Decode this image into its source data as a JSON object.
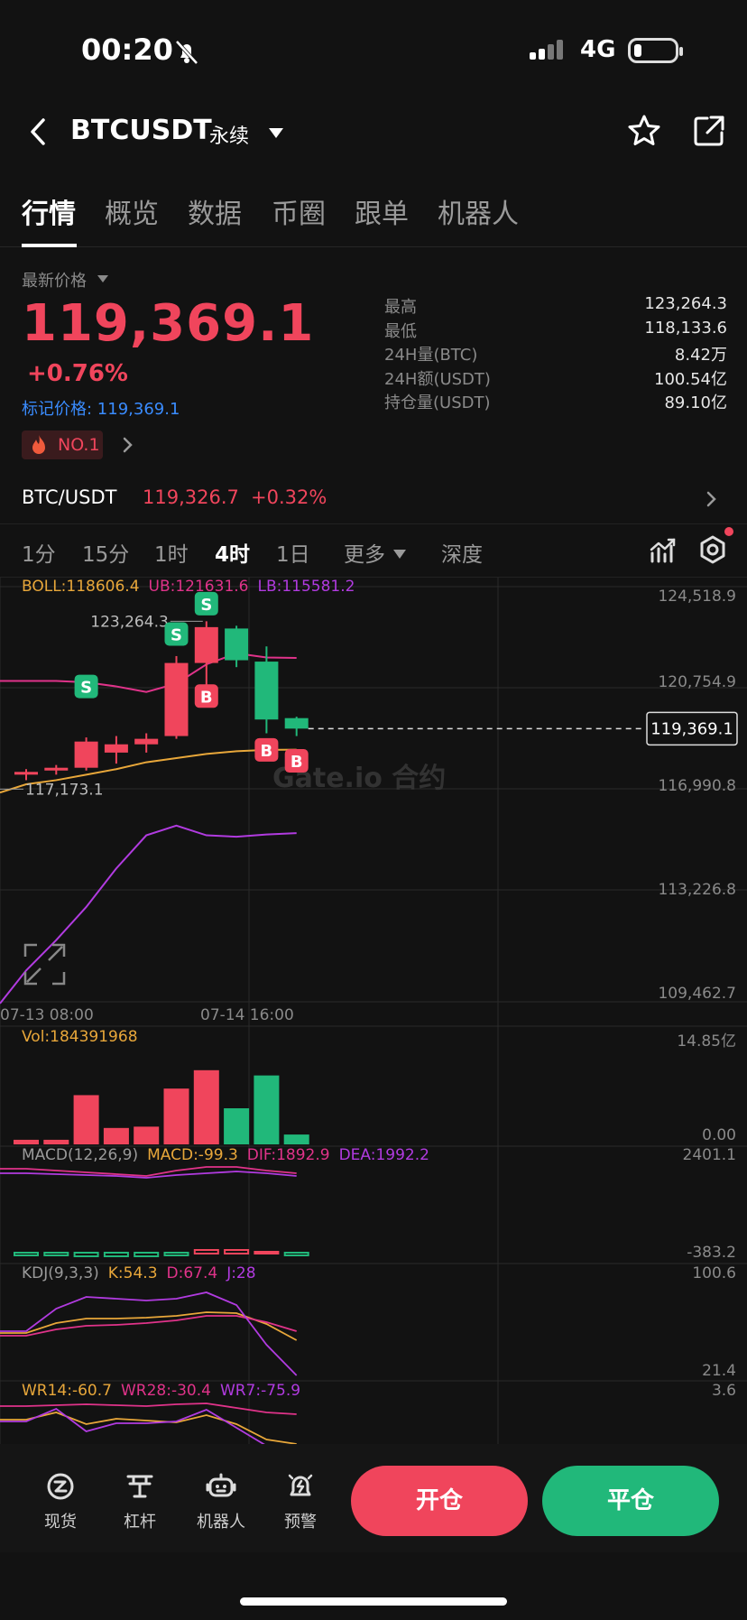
{
  "status": {
    "time": "00:20",
    "network": "4G"
  },
  "nav": {
    "symbol": "BTCUSDT",
    "contract": "永续"
  },
  "tabs": [
    "行情",
    "概览",
    "数据",
    "币圈",
    "跟单",
    "机器人"
  ],
  "price": {
    "label": "最新价格",
    "last": "119,369.1",
    "change": "+0.76%",
    "mark": "标记价格: 119,369.1",
    "rank": "NO.1"
  },
  "stats": [
    {
      "k": "最高",
      "v": "123,264.3"
    },
    {
      "k": "最低",
      "v": "118,133.6"
    },
    {
      "k": "24H量(BTC)",
      "v": "8.42万"
    },
    {
      "k": "24H额(USDT)",
      "v": "100.54亿"
    },
    {
      "k": "持仓量(USDT)",
      "v": "89.10亿"
    }
  ],
  "spot": {
    "pair": "BTC/USDT",
    "price": "119,326.7",
    "change": "+0.32%"
  },
  "intervals": {
    "items": [
      "1分",
      "15分",
      "1时",
      "4时",
      "1日"
    ],
    "more": "更多",
    "depth": "深度"
  },
  "colors": {
    "up": "#f0455c",
    "down": "#21b87a",
    "mark": "#3a8cff",
    "boll_mid": "#e8a73a",
    "boll_up": "#e0338a",
    "boll_lo": "#b13be0"
  },
  "chart_data": {
    "type": "candlestick",
    "boll": {
      "label": "BOLL:118606.4",
      "ub": "UB:121631.6",
      "lb": "LB:115581.2"
    },
    "y_ticks": [
      "124,518.9",
      "120,754.9",
      "116,990.8",
      "113,226.8",
      "109,462.7"
    ],
    "ylim": [
      109462.7,
      124518.9
    ],
    "x_ticks": [
      "07-13 08:00",
      "07-14 16:00"
    ],
    "current_price": "119,369.1",
    "current_value": 119369.1,
    "high_label": "123,264.3",
    "low_label": "117,173.1",
    "candles": [
      {
        "o": 117700,
        "h": 117900,
        "l": 117500,
        "c": 117800
      },
      {
        "o": 117850,
        "h": 118050,
        "l": 117700,
        "c": 117950
      },
      {
        "o": 117950,
        "h": 119050,
        "l": 117850,
        "c": 118900
      },
      {
        "o": 118500,
        "h": 119100,
        "l": 118100,
        "c": 118800
      },
      {
        "o": 118800,
        "h": 119200,
        "l": 118500,
        "c": 119000
      },
      {
        "o": 119100,
        "h": 122000,
        "l": 119000,
        "c": 121750
      },
      {
        "o": 121750,
        "h": 123264.3,
        "l": 120900,
        "c": 123050
      },
      {
        "o": 123000,
        "h": 123100,
        "l": 121600,
        "c": 121850
      },
      {
        "o": 121800,
        "h": 122350,
        "l": 119200,
        "c": 119700
      },
      {
        "o": 119750,
        "h": 119800,
        "l": 119100,
        "c": 119369.1
      }
    ],
    "trade_marks": [
      {
        "i": 2,
        "type": "S",
        "price": 120900
      },
      {
        "i": 5,
        "type": "S",
        "price": 122800
      },
      {
        "i": 6,
        "type": "S",
        "price": 123900
      },
      {
        "i": 6,
        "type": "B",
        "price": 120550
      },
      {
        "i": 8,
        "type": "B",
        "price": 118600
      },
      {
        "i": 9,
        "type": "B",
        "price": 118200
      }
    ],
    "boll_upper": [
      121100,
      121100,
      121050,
      120900,
      120700,
      121000,
      121700,
      122100,
      121950,
      121931.6
    ],
    "boll_middle": [
      117350,
      117500,
      117700,
      117900,
      118150,
      118300,
      118450,
      118550,
      118600,
      118606.4
    ],
    "boll_lower": [
      110600,
      111700,
      112900,
      114300,
      115500,
      115850,
      115500,
      115450,
      115530,
      115581.2
    ],
    "volume": {
      "label": "Vol:184391968",
      "max_label": "14.85亿",
      "min_label": "0.00",
      "max": 14.85,
      "values": [
        0.7,
        0.7,
        7.5,
        2.5,
        2.7,
        8.5,
        11.3,
        5.5,
        10.5,
        1.5
      ]
    },
    "macd": {
      "label": "MACD(12,26,9)",
      "macd": "MACD:-99.3",
      "dif": "DIF:1892.9",
      "dea": "DEA:1992.2",
      "max_label": "2401.1",
      "min_label": "-383.2"
    },
    "kdj": {
      "label": "KDJ(9,3,3)",
      "k": "K:54.3",
      "d": "D:67.4",
      "j": "J:28",
      "max_label": "100.6",
      "min_label": "21.4"
    },
    "wr": {
      "wr14": "WR14:-60.7",
      "wr28": "WR28:-30.4",
      "wr7": "WR7:-75.9",
      "max_label": "3.6"
    }
  },
  "bottom": {
    "nav": [
      {
        "icon": "spot-icon",
        "label": "现货"
      },
      {
        "icon": "leverage-icon",
        "label": "杠杆"
      },
      {
        "icon": "robot-icon",
        "label": "机器人"
      },
      {
        "icon": "alert-icon",
        "label": "预警"
      }
    ],
    "open": "开仓",
    "close": "平仓"
  }
}
